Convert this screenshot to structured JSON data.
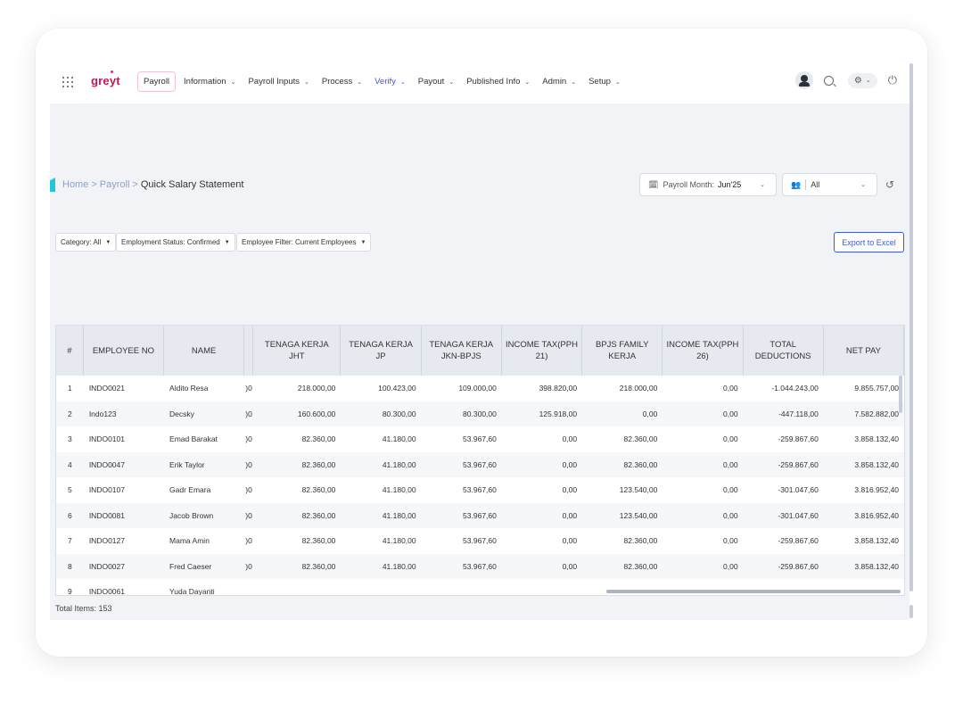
{
  "nav": {
    "logo": "greyt",
    "items": [
      {
        "label": "Payroll",
        "chevron": false,
        "style": "active"
      },
      {
        "label": "Information",
        "chevron": true,
        "style": ""
      },
      {
        "label": "Payroll Inputs",
        "chevron": true,
        "style": ""
      },
      {
        "label": "Process",
        "chevron": true,
        "style": ""
      },
      {
        "label": "Verify",
        "chevron": true,
        "style": "blue"
      },
      {
        "label": "Payout",
        "chevron": true,
        "style": ""
      },
      {
        "label": "Published Info",
        "chevron": true,
        "style": ""
      },
      {
        "label": "Admin",
        "chevron": true,
        "style": ""
      },
      {
        "label": "Setup",
        "chevron": true,
        "style": ""
      }
    ]
  },
  "breadcrumb": {
    "home": "Home",
    "section": "Payroll",
    "current": "Quick Salary Statement",
    "sep": ">"
  },
  "month": {
    "label": "Payroll Month:",
    "value": "Jun'25"
  },
  "group_select": {
    "value": "All"
  },
  "filters": [
    "Category: All",
    "Employment Status: Confirmed",
    "Employee Filter: Current Employees"
  ],
  "export_label": "Export to Excel",
  "table": {
    "headers": [
      "#",
      "EMPLOYEE NO",
      "NAME",
      "",
      "TENAGA KERJA JHT",
      "TENAGA KERJA JP",
      "TENAGA KERJA JKN-BPJS",
      "INCOME TAX(PPH 21)",
      "BPJS FAMILY KERJA",
      "INCOME TAX(PPH 26)",
      "TOTAL DEDUCTIONS",
      "NET PAY"
    ],
    "rows": [
      [
        "1",
        "INDO0021",
        "Aldito Resa",
        ")0",
        "218.000,00",
        "100.423,00",
        "109.000,00",
        "398.820,00",
        "218.000,00",
        "0,00",
        "-1.044.243,00",
        "9.855.757,00"
      ],
      [
        "2",
        "Indo123",
        "Decsky",
        ")0",
        "160.600,00",
        "80.300,00",
        "80.300,00",
        "125.918,00",
        "0,00",
        "0,00",
        "-447.118,00",
        "7.582.882,00"
      ],
      [
        "3",
        "INDO0101",
        "Emad Barakat",
        ")0",
        "82.360,00",
        "41.180,00",
        "53.967,60",
        "0,00",
        "82.360,00",
        "0,00",
        "-259.867,60",
        "3.858.132,40"
      ],
      [
        "4",
        "INDO0047",
        "Erik Taylor",
        ")0",
        "82.360,00",
        "41.180,00",
        "53.967,60",
        "0,00",
        "82.360,00",
        "0,00",
        "-259.867,60",
        "3.858.132,40"
      ],
      [
        "5",
        "INDO0107",
        "Gadr Emara",
        ")0",
        "82.360,00",
        "41.180,00",
        "53.967,60",
        "0,00",
        "123.540,00",
        "0,00",
        "-301.047,60",
        "3.816.952,40"
      ],
      [
        "6",
        "INDO0081",
        "Jacob Brown",
        ")0",
        "82.360,00",
        "41.180,00",
        "53.967,60",
        "0,00",
        "123.540,00",
        "0,00",
        "-301.047,60",
        "3.816.952,40"
      ],
      [
        "7",
        "INDO0127",
        "Mama Amin",
        ")0",
        "82.360,00",
        "41.180,00",
        "53.967,60",
        "0,00",
        "82.360,00",
        "0,00",
        "-259.867,60",
        "3.858.132,40"
      ],
      [
        "8",
        "INDO0027",
        "Fred Caeser",
        ")0",
        "82.360,00",
        "41.180,00",
        "53.967,60",
        "0,00",
        "82.360,00",
        "0,00",
        "-259.867,60",
        "3.858.132,40"
      ],
      [
        "9",
        "INDO0061",
        "Yuda Dayanti",
        "",
        "",
        "",
        "",
        "",
        "",
        "",
        "",
        ""
      ]
    ]
  },
  "total_items": "Total Items: 153",
  "icons": {
    "apps": "apps-grid-icon",
    "search": "search-icon",
    "settings": "gear-icon",
    "power": "power-icon",
    "calendar": "calendar-icon",
    "people": "people-icon",
    "history": "history-icon"
  },
  "colors": {
    "brand": "#c2185b",
    "accent": "#3b5bdb",
    "link": "#8fa0c8",
    "header_bg": "#e6e9f0",
    "page_bg": "#f1f3f6"
  }
}
